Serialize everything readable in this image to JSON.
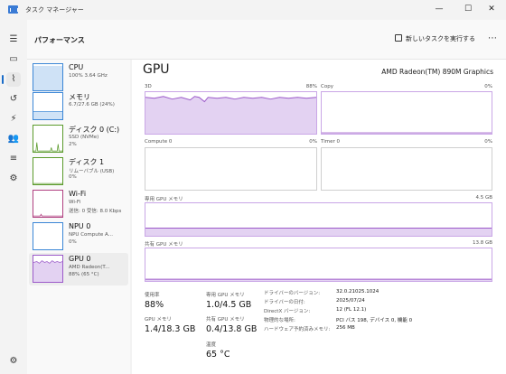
{
  "window": {
    "title": "タスク マネージャー",
    "min_glyph": "—",
    "max_glyph": "☐",
    "close_glyph": "✕"
  },
  "nav": {
    "hamburger": "☰",
    "processes": "▭",
    "performance": "⌇",
    "history": "↺",
    "startup": "⚡",
    "users": "👥",
    "details": "≡",
    "services": "⚙",
    "settings": "⚙"
  },
  "header": {
    "title": "パフォーマンス",
    "run_task": "新しいタスクを実行する",
    "more": "⋯"
  },
  "resources": [
    {
      "name": "CPU",
      "l1": "100% 3.64 GHz",
      "l2": ""
    },
    {
      "name": "メモリ",
      "l1": "6.7/27.6 GB (24%)",
      "l2": ""
    },
    {
      "name": "ディスク 0 (C:)",
      "l1": "SSD (NVMe)",
      "l2": "2%"
    },
    {
      "name": "ディスク 1",
      "l1": "リムーバブル (USB)",
      "l2": "0%"
    },
    {
      "name": "Wi-Fi",
      "l1": "Wi-Fi",
      "l2": "送信: 0  受信: 8.0 Kbps"
    },
    {
      "name": "NPU 0",
      "l1": "NPU Compute A...",
      "l2": "0%"
    },
    {
      "name": "GPU 0",
      "l1": "AMD Radeon(T...",
      "l2": "88% (65 °C)"
    }
  ],
  "gpu": {
    "title": "GPU",
    "model": "AMD Radeon(TM) 890M Graphics",
    "engines": [
      {
        "name": "3D",
        "pct": "88%"
      },
      {
        "name": "Copy",
        "pct": "0%"
      },
      {
        "name": "Compute 0",
        "pct": "0%"
      },
      {
        "name": "Timer 0",
        "pct": "0%"
      }
    ],
    "dedicated_label": "専用 GPU メモリ",
    "dedicated_max": "4.5 GB",
    "shared_label": "共有 GPU メモリ",
    "shared_max": "13.8 GB",
    "stats": {
      "util_label": "使用率",
      "util_value": "88%",
      "gpu_mem_label": "GPU メモリ",
      "gpu_mem_value": "1.4/18.3 GB",
      "ded_label": "専用 GPU メモリ",
      "ded_value": "1.0/4.5 GB",
      "shared_label": "共有 GPU メモリ",
      "shared_value": "0.4/13.8 GB",
      "temp_label": "温度",
      "temp_value": "65 °C"
    },
    "details": [
      {
        "k": "ドライバーのバージョン:",
        "v": "32.0.21025.1024"
      },
      {
        "k": "ドライバーの日付:",
        "v": "2025/07/24"
      },
      {
        "k": "DirectX バージョン:",
        "v": "12 (FL 12.1)"
      },
      {
        "k": "物理的な場所:",
        "v": "PCI バス 198, デバイス 0, 機能 0"
      },
      {
        "k": "ハードウェア予約済みメモリ:",
        "v": "256 MB"
      }
    ]
  },
  "colors": {
    "accent": "#1a6cc8",
    "gpu_line": "#9b59c9",
    "gpu_fill": "#e3d2f2",
    "cpu": "#3a86d6",
    "disk": "#5a9a2a",
    "wifi": "#b04080"
  }
}
